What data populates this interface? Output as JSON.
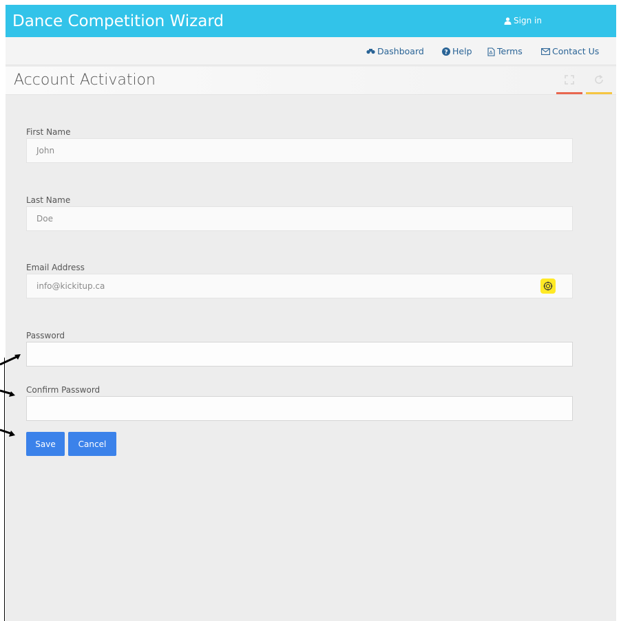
{
  "app": {
    "title": "Dance Competition Wizard",
    "sign_in": "Sign in"
  },
  "nav": {
    "items": [
      {
        "label": "Dashboard",
        "icon": "dashboard-icon"
      },
      {
        "label": "Help",
        "icon": "question-circle-icon"
      },
      {
        "label": "Terms",
        "icon": "pdf-file-icon"
      },
      {
        "label": "Contact Us",
        "icon": "envelope-icon"
      }
    ]
  },
  "panel": {
    "title": "Account Activation",
    "tools": [
      {
        "icon": "fullscreen-icon",
        "accent": "#e8674f"
      },
      {
        "icon": "refresh-icon",
        "accent": "#f5c541"
      }
    ]
  },
  "form": {
    "fields": [
      {
        "label": "First Name",
        "value": "John",
        "editable": false
      },
      {
        "label": "Last Name",
        "value": "Doe",
        "editable": false
      },
      {
        "label": "Email Address",
        "value": "info@kickitup.ca",
        "editable": false,
        "extension_icon": "autofill-target-icon"
      },
      {
        "label": "Password",
        "value": "",
        "editable": true
      },
      {
        "label": "Confirm Password",
        "value": "",
        "editable": true
      }
    ],
    "buttons": {
      "save": "Save",
      "cancel": "Cancel"
    }
  },
  "colors": {
    "topbar": "#32c3e9",
    "link": "#2a6496",
    "button": "#3b82ea",
    "badge": "#ffe925"
  }
}
